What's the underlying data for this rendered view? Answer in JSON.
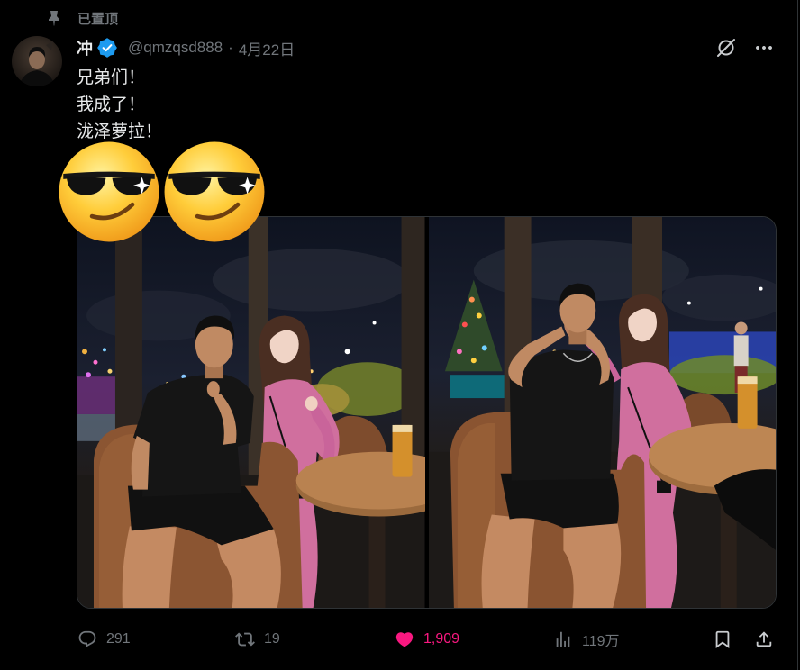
{
  "pinned": {
    "label": "已置顶",
    "icon": "pin-icon"
  },
  "author": {
    "name": "冲",
    "verified_icon": "verified-badge-icon",
    "handle": "@qmzqsd888",
    "separator": "·",
    "date": "4月22日"
  },
  "header_icons": {
    "grok": "grok-icon",
    "more": "more-icon"
  },
  "tweet": {
    "lines": [
      "兄弟们！",
      "我成了！",
      "泷泽萝拉！"
    ],
    "emoji": [
      "smiling-face-with-sunglasses",
      "smiling-face-with-sunglasses"
    ]
  },
  "actions": {
    "reply": {
      "icon": "reply-icon",
      "count": "291"
    },
    "retweet": {
      "icon": "retweet-icon",
      "count": "19"
    },
    "like": {
      "icon": "heart-icon",
      "count": "1,909",
      "active": true
    },
    "views": {
      "icon": "views-icon",
      "count": "119万"
    },
    "bookmark": {
      "icon": "bookmark-icon"
    },
    "share": {
      "icon": "share-icon"
    }
  },
  "colors": {
    "background": "#000000",
    "text": "#e7e9ea",
    "secondary": "#71767b",
    "like": "#f91880",
    "verified": "#1d9bf0"
  }
}
